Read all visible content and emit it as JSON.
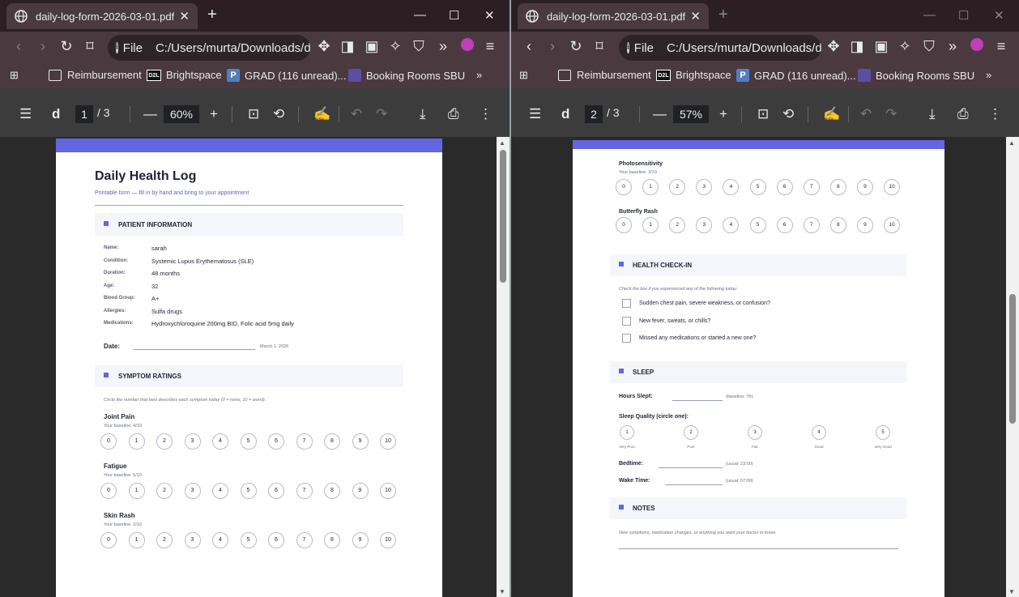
{
  "left": {
    "tab_title": "daily-log-form-2026-03-01.pdf",
    "address_scheme": "File",
    "address": "C:/Users/murta/Downloads/d",
    "bookmarks": [
      "Reimbursement",
      "Brightspace",
      "GRAD (116 unread)...",
      "Booking Rooms SBU"
    ],
    "pdf_title": "d",
    "page_current": "1",
    "page_total": "/ 3",
    "zoom": "60%"
  },
  "right": {
    "tab_title": "daily-log-form-2026-03-01.pdf",
    "address_scheme": "File",
    "address": "C:/Users/murta/Downloads/d",
    "bookmarks": [
      "Reimbursement",
      "Brightspace",
      "GRAD (116 unread)...",
      "Booking Rooms SBU"
    ],
    "pdf_title": "d",
    "page_current": "2",
    "page_total": "/ 3",
    "zoom": "57%"
  },
  "doc": {
    "title": "Daily Health Log",
    "subtitle": "Printable form — fill in by hand and bring to your appointment",
    "patient_section": "PATIENT INFORMATION",
    "patient": [
      {
        "label": "Name:",
        "value": "sarah"
      },
      {
        "label": "Condition:",
        "value": "Systemic Lupus Erythematosus (SLE)"
      },
      {
        "label": "Duration:",
        "value": "48 months"
      },
      {
        "label": "Age:",
        "value": "32"
      },
      {
        "label": "Blood Group:",
        "value": "A+"
      },
      {
        "label": "Allergies:",
        "value": "Sulfa drugs"
      },
      {
        "label": "Medications:",
        "value": "Hydroxychloroquine 200mg BID, Folic acid 5mg daily"
      }
    ],
    "date_label": "Date:",
    "date_value": "March 1, 2026",
    "symptom_section": "SYMPTOM RATINGS",
    "symptom_hint": "Circle the number that best describes each symptom today (0 = none, 10 = worst).",
    "scale": [
      "0",
      "1",
      "2",
      "3",
      "4",
      "5",
      "6",
      "7",
      "8",
      "9",
      "10"
    ],
    "symptoms_p1": [
      {
        "name": "Joint Pain",
        "baseline": "Your baseline: 4/10"
      },
      {
        "name": "Fatigue",
        "baseline": "Your baseline: 5/10"
      },
      {
        "name": "Skin Rash",
        "baseline": "Your baseline: 2/10"
      }
    ],
    "symptoms_p2": [
      {
        "name": "Photosensitivity",
        "baseline": "Your baseline: 3/10"
      },
      {
        "name": "Butterfly Rash",
        "baseline": ""
      }
    ],
    "checkin_section": "HEALTH CHECK-IN",
    "checkin_hint": "Check the box if you experienced any of the following today:",
    "checkin_items": [
      "Sudden chest pain, severe weakness, or confusion?",
      "New fever, sweats, or chills?",
      "Missed any medications or started a new one?"
    ],
    "sleep_section": "SLEEP",
    "hours_label": "Hours Slept:",
    "hours_hint": "(baseline: 7h)",
    "quality_label": "Sleep Quality (circle one):",
    "quality": [
      {
        "n": "1",
        "t": "Very Poor"
      },
      {
        "n": "2",
        "t": "Poor"
      },
      {
        "n": "3",
        "t": "Fair"
      },
      {
        "n": "4",
        "t": "Good"
      },
      {
        "n": "5",
        "t": "Very Good"
      }
    ],
    "bedtime_label": "Bedtime:",
    "bedtime_hint": "(usual: 23:00)",
    "wake_label": "Wake Time:",
    "wake_hint": "(usual: 07:00)",
    "notes_section": "NOTES",
    "notes_hint": "New symptoms, medication changes, or anything you want your doctor to know:"
  }
}
